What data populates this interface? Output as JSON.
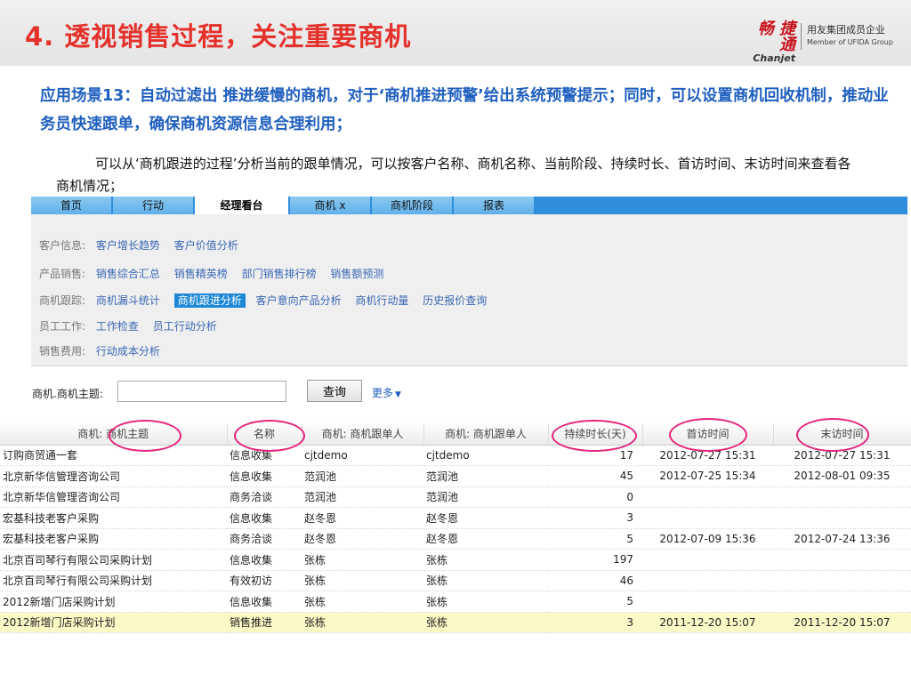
{
  "header": {
    "title": "4. 透视销售过程，关注重要商机",
    "brand_cn": "畅 捷 通",
    "brand_en": "Chanjet",
    "group_cn": "用友集团成员企业",
    "group_en": "Member of UFIDA Group"
  },
  "scenario": "应用场景13：自动过滤出 推进缓慢的商机，对于‘商机推进预警’给出系统预警提示；同时，可以设置商机回收机制，推动业务员快速跟单，确保商机资源信息合理利用；",
  "description": "可以从‘商机跟进的过程’分析当前的跟单情况，可以按客户名称、商机名称、当前阶段、持续时长、首访时间、末访时间来查看各商机情况；",
  "tabs": [
    "首页",
    "行动",
    "经理看台",
    "商机 x",
    "商机阶段",
    "报表"
  ],
  "menu": {
    "customer": {
      "label": "客户信息:",
      "links": [
        "客户增长趋势",
        "客户价值分析"
      ]
    },
    "product": {
      "label": "产品销售:",
      "links": [
        "销售综合汇总",
        "销售精英榜",
        "部门销售排行榜",
        "销售额预测"
      ]
    },
    "opportunity": {
      "label": "商机跟踪:",
      "links": [
        "商机漏斗统计",
        "商机跟进分析",
        "客户意向产品分析",
        "商机行动量",
        "历史报价查询"
      ]
    },
    "staff": {
      "label": "员工工作:",
      "links": [
        "工作检查",
        "员工行动分析"
      ]
    },
    "expense": {
      "label": "销售费用:",
      "links": [
        "行动成本分析"
      ]
    }
  },
  "search": {
    "label": "商机.商机主题:",
    "value": "",
    "query_button": "查询",
    "more_link": "更多"
  },
  "table": {
    "headers": [
      "商机: 商机主题",
      "名称",
      "商机: 商机跟单人",
      "商机: 商机跟单人",
      "持续时长(天)",
      "首访时间",
      "末访时间"
    ],
    "rows": [
      [
        "订购商贸通一套",
        "信息收集",
        "cjtdemo",
        "cjtdemo",
        "17",
        "2012-07-27 15:31",
        "2012-07-27 15:31"
      ],
      [
        "北京新华信管理咨询公司",
        "信息收集",
        "范润池",
        "范润池",
        "45",
        "2012-07-25 15:34",
        "2012-08-01 09:35"
      ],
      [
        "北京新华信管理咨询公司",
        "商务洽谈",
        "范润池",
        "范润池",
        "0",
        "",
        ""
      ],
      [
        "宏基科技老客户采购",
        "信息收集",
        "赵冬恩",
        "赵冬恩",
        "3",
        "",
        ""
      ],
      [
        "宏基科技老客户采购",
        "商务洽谈",
        "赵冬恩",
        "赵冬恩",
        "5",
        "2012-07-09 15:36",
        "2012-07-24 13:36"
      ],
      [
        "北京百司琴行有限公司采购计划",
        "信息收集",
        "张栋",
        "张栋",
        "197",
        "",
        ""
      ],
      [
        "北京百司琴行有限公司采购计划",
        "有效初访",
        "张栋",
        "张栋",
        "46",
        "",
        ""
      ],
      [
        "2012新增门店采购计划",
        "信息收集",
        "张栋",
        "张栋",
        "5",
        "",
        ""
      ],
      [
        "2012新增门店采购计划",
        "销售推进",
        "张栋",
        "张栋",
        "3",
        "2011-12-20 15:07",
        "2011-12-20 15:07"
      ]
    ]
  },
  "colors": {
    "title": "#e5312c",
    "scenario": "#1f5fbf",
    "tabbar": "#2f8fdd",
    "annotation": "#e5227d",
    "highlight_row": "#fbf9c6"
  }
}
